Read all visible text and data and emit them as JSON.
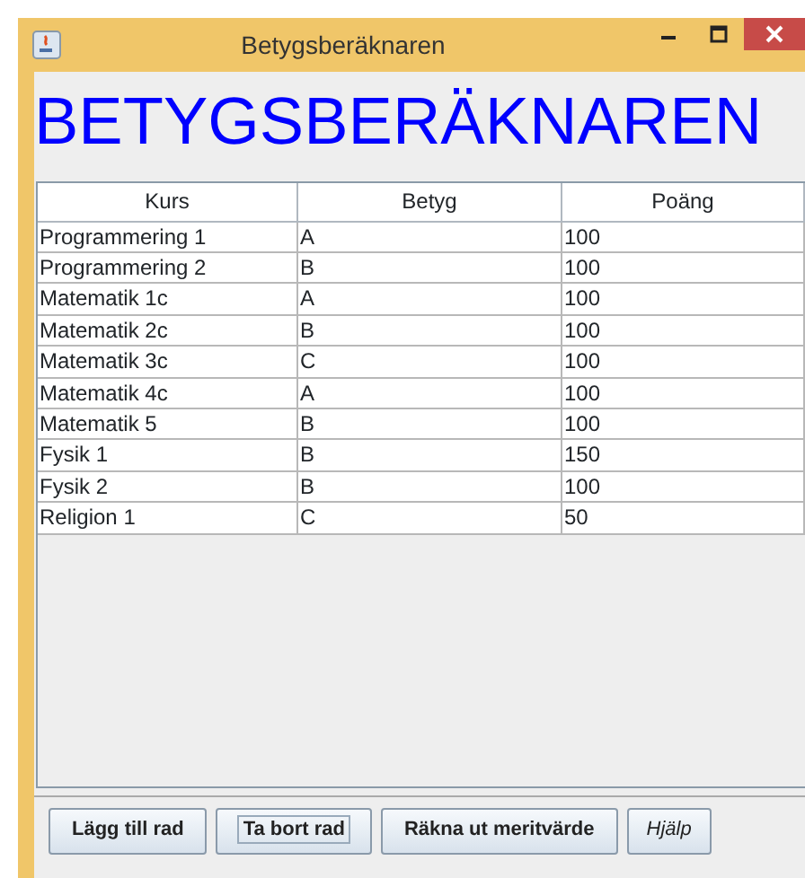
{
  "window": {
    "title": "Betygsberäknaren"
  },
  "heading": "BETYGSBERÄKNAREN",
  "table": {
    "columns": [
      "Kurs",
      "Betyg",
      "Poäng"
    ],
    "rows": [
      [
        "Programmering 1",
        "A",
        "100"
      ],
      [
        "Programmering 2",
        "B",
        "100"
      ],
      [
        "Matematik 1c",
        "A",
        "100"
      ],
      [
        "Matematik 2c",
        "B",
        "100"
      ],
      [
        "Matematik 3c",
        "C",
        "100"
      ],
      [
        "Matematik 4c",
        "A",
        "100"
      ],
      [
        "Matematik 5",
        "B",
        "100"
      ],
      [
        "Fysik 1",
        "B",
        "150"
      ],
      [
        "Fysik 2",
        "B",
        "100"
      ],
      [
        "Religion 1",
        "C",
        "50"
      ]
    ]
  },
  "buttons": [
    {
      "label": "Lägg till rad",
      "focused": false,
      "italic": false
    },
    {
      "label": "Ta bort rad",
      "focused": true,
      "italic": false
    },
    {
      "label": "Räkna ut meritvärde",
      "focused": false,
      "italic": false
    },
    {
      "label": "Hjälp",
      "focused": false,
      "italic": true
    }
  ]
}
